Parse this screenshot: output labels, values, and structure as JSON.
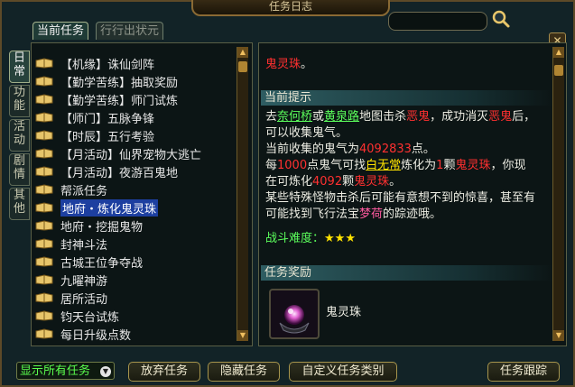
{
  "window": {
    "title": "任务日志"
  },
  "tabs": [
    {
      "label": "当前任务",
      "active": true
    },
    {
      "label": "行行出状元",
      "active": false
    }
  ],
  "side_tabs": [
    {
      "label": "日常",
      "active": true
    },
    {
      "label": "功能",
      "active": false
    },
    {
      "label": "活动",
      "active": false
    },
    {
      "label": "剧情",
      "active": false
    },
    {
      "label": "其他",
      "active": false
    }
  ],
  "quests": [
    "【机缘】诛仙剑阵",
    "【勤学苦练】抽取奖励",
    "【勤学苦练】师门试炼",
    "【师门】五脉争锋",
    "【时辰】五行考验",
    "【月活动】仙界宠物大逃亡",
    "【月活动】夜游百鬼地",
    "帮派任务",
    "地府・炼化鬼灵珠",
    "地府・挖掘鬼物",
    "封神斗法",
    "古城王位争夺战",
    "九曜神游",
    "居所活动",
    "钧天台试炼",
    "每日升级点数"
  ],
  "selected_quest_index": 8,
  "detail": {
    "top_line_red": "鬼灵珠",
    "top_line_end": "。",
    "current_hint_header": "当前提示",
    "hint_parts": {
      "p1": "去",
      "loc1": "奈何桥",
      "p2": "或",
      "loc2": "黄泉路",
      "p3": "地图击杀",
      "mon1": "恶鬼",
      "p4": "，成功消灭",
      "mon2": "恶鬼",
      "p5": "后，可以收集鬼气。",
      "p6": "当前收集的鬼气为",
      "amount": "4092833",
      "p7": "点。",
      "p8": "每",
      "cost": "1000",
      "p9": "点鬼气可找",
      "npc": "白无常",
      "p10": "炼化为",
      "one": "1",
      "p11": "颗",
      "item1": "鬼灵珠",
      "p12": "，你现在可炼化",
      "can": "4092",
      "p13": "颗",
      "item2": "鬼灵珠",
      "p14": "。",
      "p15": "某些特殊怪物击杀后可能有意想不到的惊喜，甚至有可能找到飞行法宝",
      "treasure": "梦荷",
      "p16": "的踪迹哦。"
    },
    "difficulty_label": "战斗难度：",
    "difficulty_stars": "★★★",
    "reward_header": "任务奖励",
    "reward_item": "鬼灵珠"
  },
  "footer": {
    "filter_value": "显示所有任务",
    "abandon": "放弃任务",
    "hide": "隐藏任务",
    "custom_type": "自定义任务类别",
    "track": "任务跟踪"
  },
  "colors": {
    "location": "#5cff5c",
    "monster": "#ff3030",
    "number": "#ff3030",
    "npc": "#ffe200",
    "treasure": "#ff5aa0",
    "selected_quest": "#5aa0ff",
    "frame": "#a7954d"
  }
}
